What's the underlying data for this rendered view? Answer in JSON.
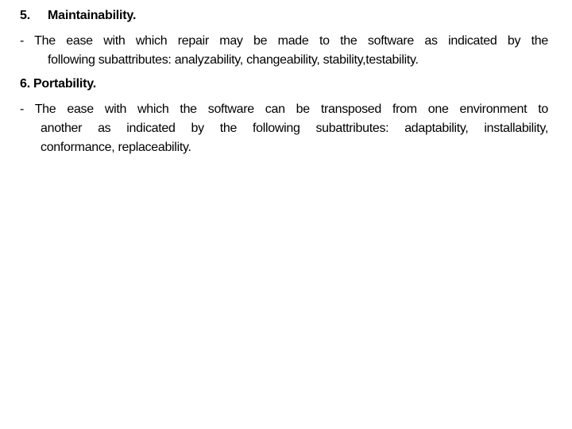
{
  "sections": [
    {
      "number": "5.",
      "title": "Maintainability.",
      "lines": [
        "- The ease with which repair may be made to the software as indicated by the",
        "following subattributes: analyzability, changeability, stability,testability."
      ]
    },
    {
      "number": "6.",
      "title": "Portability.",
      "lines": [
        "- The ease with which the software can be transposed from one environment to",
        "another as indicated by the following subattributes: adaptability, installability,",
        "conformance, replaceability."
      ]
    }
  ]
}
